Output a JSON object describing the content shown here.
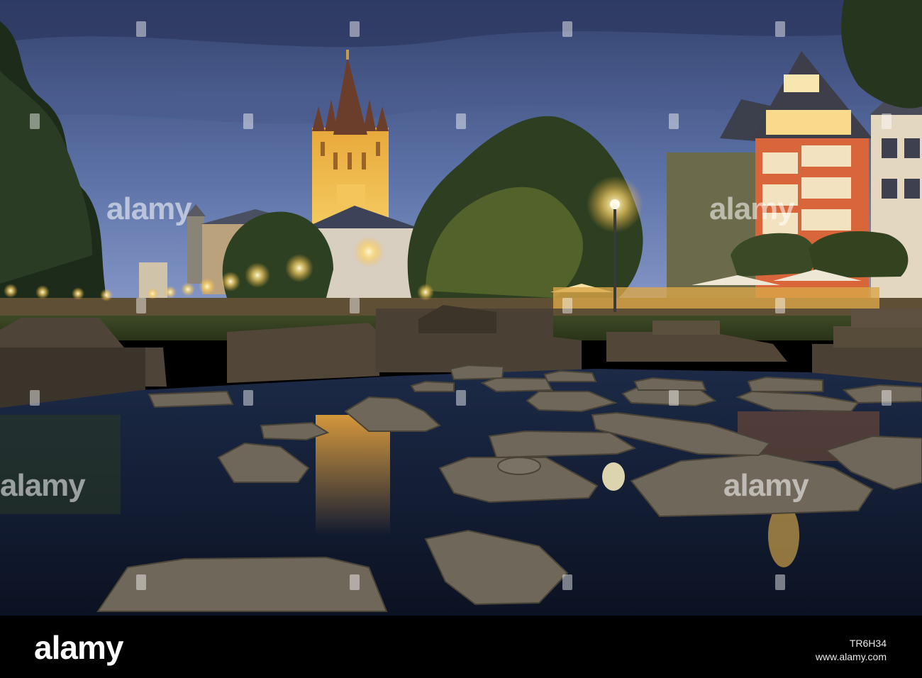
{
  "watermark": {
    "brand": "alamy",
    "image_id": "TR6H34",
    "site": "www.alamy.com"
  },
  "colors": {
    "sky_top": "#3a4a78",
    "sky_bottom": "#6f86b8",
    "church_glow": "#f2c250",
    "lamp": "#fff3c2",
    "water": "#14203a",
    "stone": "#6e6558"
  }
}
